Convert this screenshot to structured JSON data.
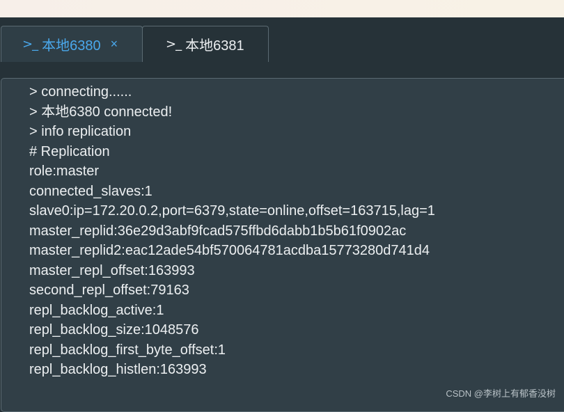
{
  "tabs": [
    {
      "prompt": ">_",
      "label": "本地6380",
      "close": "×",
      "active": true
    },
    {
      "prompt": ">_",
      "label": "本地6381",
      "active": false
    }
  ],
  "terminal": {
    "lines": [
      "> connecting......",
      "> 本地6380 connected!",
      "> info replication",
      "# Replication",
      "role:master",
      "connected_slaves:1",
      "slave0:ip=172.20.0.2,port=6379,state=online,offset=163715,lag=1",
      "master_replid:36e29d3abf9fcad575ffbd6dabb1b5b61f0902ac",
      "master_replid2:eac12ade54bf570064781acdba15773280d741d4",
      "master_repl_offset:163993",
      "second_repl_offset:79163",
      "repl_backlog_active:1",
      "repl_backlog_size:1048576",
      "repl_backlog_first_byte_offset:1",
      "repl_backlog_histlen:163993"
    ]
  },
  "watermark": "CSDN @李树上有郁香没树",
  "colors": {
    "background": "#263238",
    "terminal_bg": "#313f47",
    "active_tab_text": "#4aa8ec",
    "text": "#eceff1"
  }
}
